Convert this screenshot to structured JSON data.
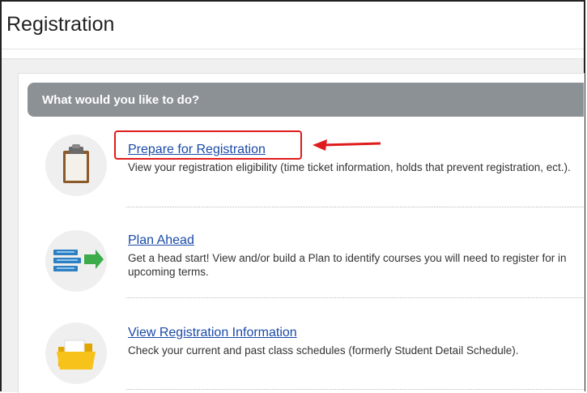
{
  "page": {
    "title": "Registration"
  },
  "panel": {
    "header": "What would you like to do?"
  },
  "items": [
    {
      "title": "Prepare for Registration",
      "description": "View your registration eligibility (time ticket information, holds that prevent registration, ect.).",
      "icon": "clipboard-icon"
    },
    {
      "title": "Plan Ahead",
      "description": "Get a head start! View and/or build a Plan to identify courses you will need to register for in upcoming terms.",
      "icon": "plan-list-icon"
    },
    {
      "title": "View Registration Information",
      "description": "Check your current and past class schedules (formerly Student Detail Schedule).",
      "icon": "folder-icon"
    }
  ],
  "annotation": {
    "highlight_color": "#e01b1b"
  }
}
